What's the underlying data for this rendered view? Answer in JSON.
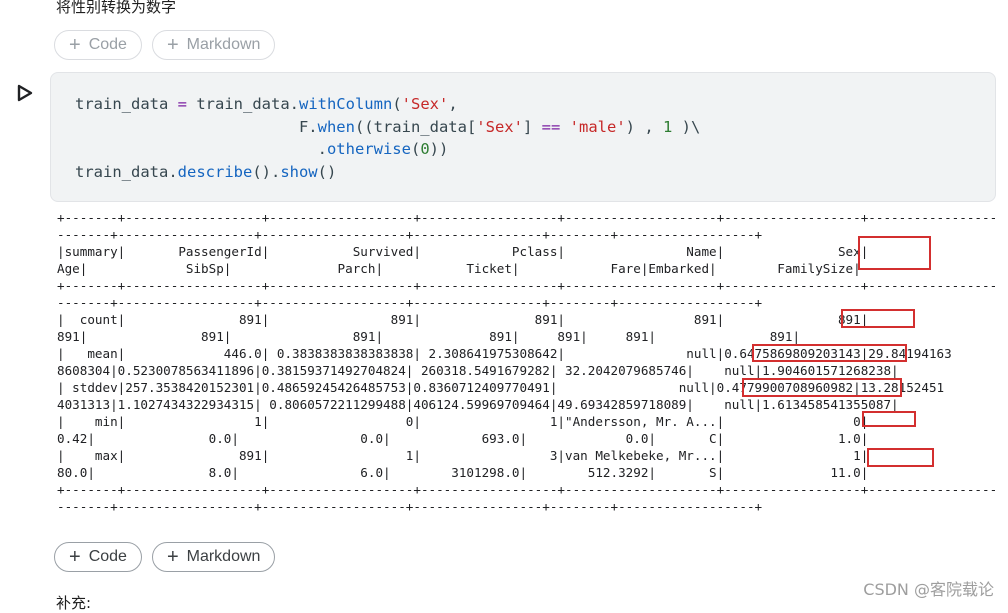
{
  "notebook": {
    "top_text": "将性别转换为数字",
    "bottom_text": "补充:",
    "add_code_label": "Code",
    "add_markdown_label": "Markdown",
    "plus_symbol": "+"
  },
  "code_cell": {
    "lines": [
      "train_data = train_data.withColumn('Sex',",
      "                        F.when((train_data['Sex'] == 'male') , 1 )\\",
      "                          .otherwise(0))",
      "train_data.describe().show()"
    ]
  },
  "output": {
    "lines": [
      "+-------+------------------+-------------------+------------------+--------------------+------------------+-----------------",
      "-------+------------------+-------------------+-----------------+--------+------------------+",
      "|summary|       PassengerId|           Survived|            Pclass|                Name|               Sex|                 ",
      "Age|             SibSp|              Parch|           Ticket|            Fare|Embarked|        FamilySize|",
      "+-------+------------------+-------------------+------------------+--------------------+------------------+-----------------",
      "-------+------------------+-------------------+-----------------+--------+------------------+",
      "|  count|               891|                891|               891|                 891|               891|                 ",
      "891|               891|                891|              891|     891|     891|               891|",
      "|   mean|             446.0| 0.3838383838383838| 2.308641975308642|                null|0.6475869809203143|29.84194163",
      "8608304|0.5230078563411896|0.38159371492704824| 260318.5491679282| 32.2042079685746|    null|1.904601571268238|",
      "| stddev|257.3538420152301|0.48659245426485753|0.8360712409770491|                null|0.4779900708960982|13.28152451",
      "4031313|1.1027434322934315| 0.8060572211299488|406124.59969709464|49.69342859718089|    null|1.613458541355087|",
      "|    min|                 1|                  0|                 1|\"Andersson, Mr. A...|                 0|                 ",
      "0.42|               0.0|                0.0|            693.0|             0.0|       C|               1.0|",
      "|    max|               891|                  1|                 3|van Melkebeke, Mr...|                 1|                 ",
      "80.0|               8.0|                6.0|        3101298.0|        512.3292|       S|              11.0|",
      "+-------+------------------+-------------------+------------------+--------------------+------------------+-----------------",
      "-------+------------------+-------------------+-----------------+--------+------------------+"
    ]
  },
  "watermark": "CSDN @客院载论",
  "colors": {
    "highlight": "#d32f2f",
    "cell_bg": "#f1f3f4"
  }
}
